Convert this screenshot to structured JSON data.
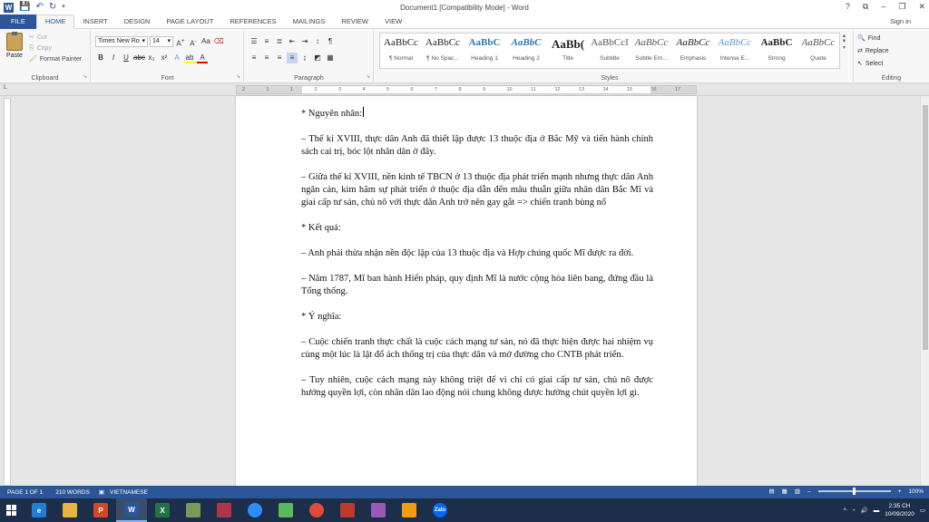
{
  "window": {
    "title": "Document1 [Compatibility Mode] - Word",
    "controls": [
      "?",
      "⧉",
      "–",
      "❐",
      "✕"
    ]
  },
  "tabs": {
    "file": "FILE",
    "items": [
      "HOME",
      "INSERT",
      "DESIGN",
      "PAGE LAYOUT",
      "REFERENCES",
      "MAILINGS",
      "REVIEW",
      "VIEW"
    ],
    "active": "HOME",
    "sign_in": "Sign in"
  },
  "clipboard": {
    "paste": "Paste",
    "cut": "Cut",
    "copy": "Copy",
    "format_painter": "Format Painter",
    "label": "Clipboard"
  },
  "font": {
    "name": "Times New Ro",
    "size": "14",
    "label": "Font"
  },
  "paragraph": {
    "label": "Paragraph"
  },
  "styles": {
    "label": "Styles",
    "items": [
      {
        "sample": "AaBbCc",
        "name": "¶ Normal"
      },
      {
        "sample": "AaBbCc",
        "name": "¶ No Spac..."
      },
      {
        "sample": "AaBbC",
        "name": "Heading 1"
      },
      {
        "sample": "AaBbC",
        "name": "Heading 2"
      },
      {
        "sample": "AaBb(",
        "name": "Title"
      },
      {
        "sample": "AaBbCcI",
        "name": "Subtitle"
      },
      {
        "sample": "AaBbCc",
        "name": "Subtle Em..."
      },
      {
        "sample": "AaBbCc",
        "name": "Emphasis"
      },
      {
        "sample": "AaBbCc",
        "name": "Intense E..."
      },
      {
        "sample": "AaBbC",
        "name": "Strong"
      },
      {
        "sample": "AaBbCc",
        "name": "Quote"
      }
    ]
  },
  "editing": {
    "find": "Find",
    "replace": "Replace",
    "select": "Select",
    "label": "Editing"
  },
  "ruler": {
    "ticks": [
      "2",
      "1",
      "1",
      "2",
      "3",
      "4",
      "5",
      "6",
      "7",
      "8",
      "9",
      "10",
      "11",
      "12",
      "13",
      "14",
      "15",
      "16",
      "17"
    ]
  },
  "document": {
    "paragraphs": [
      "* Nguyên nhân:",
      "– Thế kỉ XVIII, thực dân Anh đã thiết lập được 13 thuộc địa ở Bắc Mỹ và tiến hành chính sách cai trị, bóc lột nhân dân ở đây.",
      "– Giữa thế kỉ XVIII, nền kinh tế TBCN ở 13 thuộc địa phát triển mạnh nhưng thực dân Anh ngăn cản, kìm hãm sự phát triển ở thuộc địa dẫn đến mâu thuẫn giữa nhân dân Bắc Mĩ và giai cấp tư sản, chủ nô với thực dân Anh trở nên gay gắt => chiến tranh bùng nổ",
      "* Kết quả:",
      "– Anh phải thừa nhận nền độc lập của 13 thuộc địa và Hợp chúng quốc Mĩ được ra đời.",
      "– Năm 1787, Mĩ ban hành Hiến pháp, quy định Mĩ là nước cộng hòa liên bang, đứng đầu là Tổng thống.",
      "* Ý nghĩa:",
      "– Cuộc chiến tranh thực chất là cuộc cách mạng tư sản, nó đã thực hiện được hai nhiệm vụ cùng một lúc là lật đổ ách thống trị của thực dân và mở đường cho CNTB phát triển.",
      "– Tuy nhiên, cuộc cách mạng này không triệt để vì chỉ có giai cấp tư sản, chủ nô được hưởng quyền lợi, còn nhân dân lao động nói chung không được hưởng chút quyền lợi gì."
    ]
  },
  "statusbar": {
    "page": "PAGE 1 OF 1",
    "words": "210 WORDS",
    "language": "VIETNAMESE",
    "zoom": "100%"
  },
  "taskbar": {
    "apps": [
      {
        "name": "edge",
        "label": "e",
        "color": "#1e7fd6"
      },
      {
        "name": "file-explorer",
        "label": "",
        "color": "#e9b53c"
      },
      {
        "name": "powerpoint",
        "label": "P",
        "color": "#d24726"
      },
      {
        "name": "word",
        "label": "W",
        "color": "#2b579a"
      },
      {
        "name": "excel",
        "label": "X",
        "color": "#217346"
      },
      {
        "name": "paint",
        "label": "",
        "color": "#7a9a5a"
      },
      {
        "name": "snipping",
        "label": "",
        "color": "#b0354a"
      },
      {
        "name": "zoom",
        "label": "",
        "color": "#2d8cff"
      },
      {
        "name": "refresh-app",
        "label": "",
        "color": "#5cb85c"
      },
      {
        "name": "chrome",
        "label": "",
        "color": "#dd4b39"
      },
      {
        "name": "app-red",
        "label": "",
        "color": "#c0392b"
      },
      {
        "name": "app-paint2",
        "label": "",
        "color": "#9b59b6"
      },
      {
        "name": "app-yellow",
        "label": "",
        "color": "#f39c12"
      },
      {
        "name": "zalo",
        "label": "Zalo",
        "color": "#0068ff"
      }
    ],
    "time": "2:35 CH",
    "date": "10/09/2020"
  }
}
